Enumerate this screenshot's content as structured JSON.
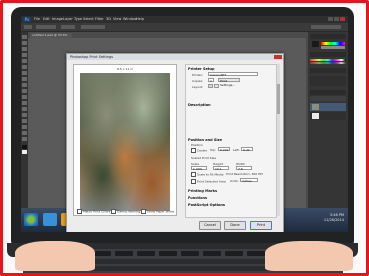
{
  "menus": [
    "File",
    "Edit",
    "Image",
    "Layer",
    "Type",
    "Select",
    "Filter",
    "3D",
    "View",
    "Window",
    "Help"
  ],
  "app_logo": "Ps",
  "document_tab": "untitled-1.psd @ 33.3%",
  "dialog": {
    "title": "Photoshop Print Settings",
    "preview_label": "8.5 x 11 in",
    "printer_setup_title": "Printer Setup",
    "printer_label": "Printer:",
    "printer_value": "Canon PRT",
    "copies_label": "Copies:",
    "copies_value": "1",
    "print_settings_button": "Print Settings...",
    "layout_label": "Layout:",
    "description_title": "Description",
    "position_size_title": "Position and Size",
    "position_label": "Position",
    "center_label": "Center",
    "top_label": "Top:",
    "top_value": "0.222",
    "left_label": "Left:",
    "left_value": "0.42",
    "scaled_title": "Scaled Print Size",
    "scale_label": "Scale",
    "height_label": "Height",
    "width_label": "Width",
    "scale_value": "1.00%",
    "height_value": "10.1",
    "width_value": "7.6",
    "scale_to_fit_label": "Scale to Fit Media",
    "resolution_label": "Print Resolution: 300 PPI",
    "bounding_label": "Print Selected Area",
    "units_label": "Units:",
    "units_value": "inches",
    "printing_marks": "Printing Marks",
    "functions": "Functions",
    "postscript": "PostScript Options",
    "preview_checks": [
      "Match Print Colors",
      "Gamut Warning",
      "Show Paper White"
    ],
    "buttons": {
      "cancel": "Cancel",
      "done": "Done",
      "print": "Print"
    }
  },
  "clock": {
    "time": "3:46 PM",
    "date": "11/26/2014"
  },
  "colors": {
    "frame_red": "#e8141c",
    "skin": "#f3c8ae"
  },
  "icons": [
    "photoshop-logo-icon",
    "close-icon",
    "minimize-icon",
    "maximize-icon",
    "windows-start-icon",
    "explorer-icon",
    "chrome-icon",
    "photoshop-taskbar-icon"
  ]
}
